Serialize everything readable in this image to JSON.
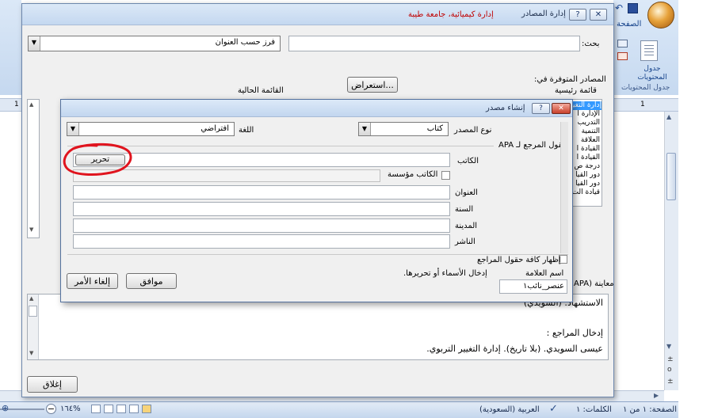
{
  "word": {
    "ribbon_tab_visible": "الصفحة",
    "ribbon_group_label": "جدول المحتويات",
    "toc_button_label": "جدول المحتويات",
    "ruler_left_number": "1",
    "ruler_right_number": "1"
  },
  "manager": {
    "title": "إدارة المصادر",
    "doc_title": "إدارة كيميائية، جامعة طيبة",
    "search_label": "بحث:",
    "search_value": "",
    "sort_value": "فرز حسب العنوان",
    "available_label": "المصادر المتوفرة في:",
    "master_list_label": "قائمة رئيسية",
    "current_list_label": "القائمة الحالية",
    "browse_button": "استعراض...",
    "available_items": [
      "إدارة التغيير",
      "الإدارة ا",
      "التدريب",
      "التنمية",
      "العلاقة",
      "القيادة ا",
      "القيادة ا",
      "درجة ص",
      "دور القيا",
      "دور القيا",
      "قيادة الت"
    ],
    "preview_label": "معاينة (APA",
    "preview_citation": "الاستشهاد: (السويدي)",
    "preview_bibliography_label": "إدخال المراجع :",
    "preview_reference": "عيسى السويدي. (بلا تاريخ). إدارة التغيير التربوي.",
    "close_button": "إغلاق",
    "help_icon": "?",
    "close_icon": "✕"
  },
  "create": {
    "title": "إنشاء مصدر",
    "source_type_label": "نوع المصدر",
    "source_type_value": "كتاب",
    "language_label": "اللغة",
    "language_value": "افتراضي",
    "fields_heading": "حقول المرجع لـ APA",
    "author_label": "الكاتب",
    "edit_button": "تحرير",
    "corporate_author_label": "الكاتب مؤسسة",
    "title_label": "العنوان",
    "year_label": "السنة",
    "city_label": "المدينة",
    "publisher_label": "الناشر",
    "author_value": "",
    "title_value": "",
    "year_value": "",
    "city_value": "",
    "publisher_value": "",
    "show_all_label": "إظهار كافة حقول المراجع",
    "tag_name_label": "اسم العلامة",
    "names_hint": "إدخال الأسماء أو تحريرها.",
    "tag_name_value": "عنصر_نائب١",
    "ok_button": "موافق",
    "cancel_button": "إلغاء الأمر",
    "help_icon": "?",
    "close_icon": "✕"
  },
  "statusbar": {
    "page": "الصفحة: ١ من ١",
    "words": "الكلمات: ١",
    "language": "العربية (السعودية)",
    "zoom": "١٦٤%"
  },
  "colors": {
    "annotation_red": "#e0141e",
    "window_blue": "#c7d9ef",
    "title_red_text": "#c00000"
  }
}
